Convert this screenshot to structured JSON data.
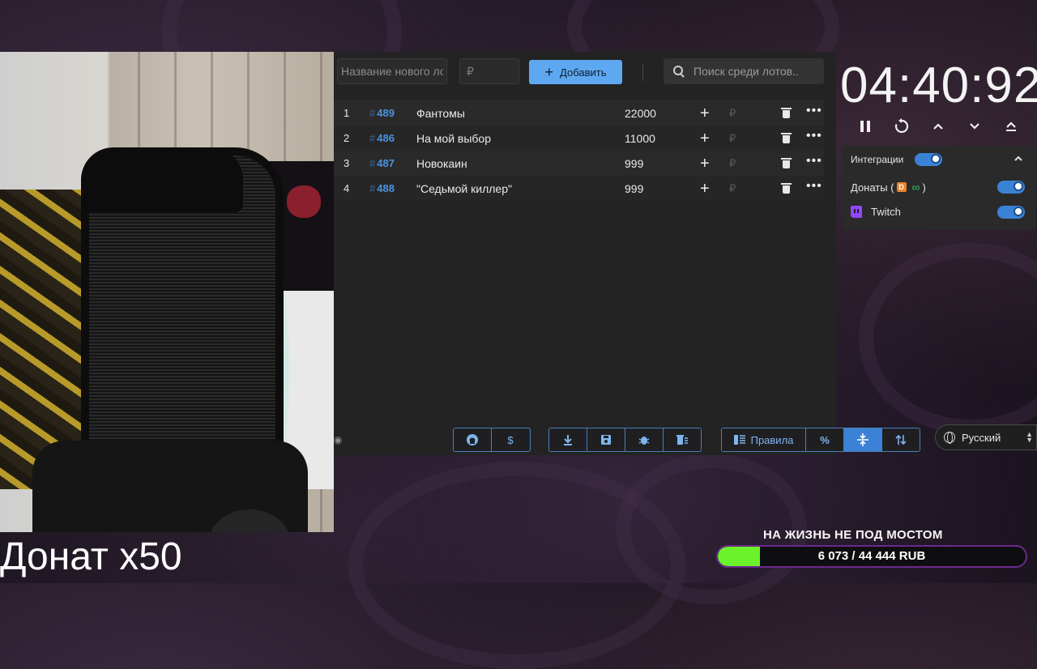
{
  "auction": {
    "new_lot_placeholder": "Название нового ло",
    "amount_placeholder": "₽",
    "add_button_label": "Добавить",
    "search_placeholder": "Поиск среди лотов..",
    "lots": [
      {
        "num": "1",
        "id": "489",
        "title": "Фантомы",
        "amount": "22000",
        "currency": "₽"
      },
      {
        "num": "2",
        "id": "486",
        "title": "На мой выбор",
        "amount": "11000",
        "currency": "₽"
      },
      {
        "num": "3",
        "id": "487",
        "title": "Новокаин",
        "amount": "999",
        "currency": "₽"
      },
      {
        "num": "4",
        "id": "488",
        "title": "\"Седьмой киллер\"",
        "amount": "999",
        "currency": "₽"
      }
    ]
  },
  "toolbar": {
    "rules_label": "Правила",
    "dollar_label": "$",
    "percent_label": "%"
  },
  "language": {
    "selected": "Русский"
  },
  "timer": {
    "value": "04:40:92"
  },
  "integrations": {
    "header": "Интеграции",
    "donations_label": "Донаты (",
    "donations_suffix": ")",
    "twitch_label": "Twitch",
    "donations_icon_letter": "D"
  },
  "stream": {
    "donate_caption": "Донат x50",
    "goal_title": "НА ЖИЗНЬ НЕ ПОД МОСТОМ",
    "goal_text": "6 073 / 44 444 RUB",
    "goal_fraction": 0.137,
    "goal_color": "#6cf22a"
  }
}
